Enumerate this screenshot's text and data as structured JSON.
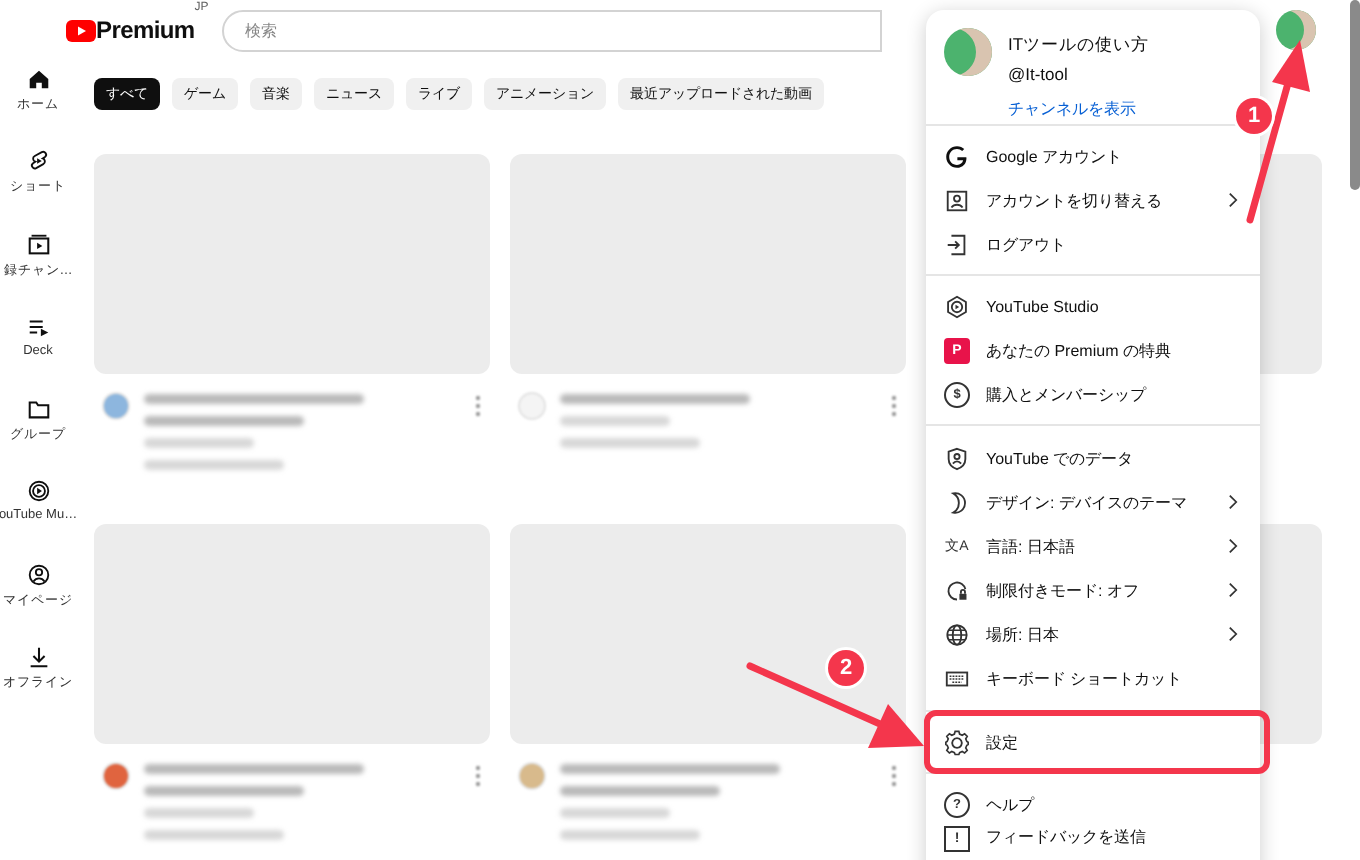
{
  "logo": {
    "text": "Premium",
    "region": "JP"
  },
  "search": {
    "placeholder": "検索"
  },
  "sidebar": {
    "items": [
      {
        "label": "ホーム"
      },
      {
        "label": "ショート"
      },
      {
        "label": "録チャン…"
      },
      {
        "label": "Deck"
      },
      {
        "label": "グループ"
      },
      {
        "label": "ouTube Mu…"
      },
      {
        "label": "マイページ"
      },
      {
        "label": "オフライン"
      }
    ]
  },
  "chips": [
    {
      "label": "すべて",
      "selected": true
    },
    {
      "label": "ゲーム",
      "selected": false
    },
    {
      "label": "音楽",
      "selected": false
    },
    {
      "label": "ニュース",
      "selected": false
    },
    {
      "label": "ライブ",
      "selected": false
    },
    {
      "label": "アニメーション",
      "selected": false
    },
    {
      "label": "最近アップロードされた動画",
      "selected": false
    }
  ],
  "videos": [
    {
      "kind": "two-line",
      "color": "#8db6de"
    },
    {
      "kind": "one-line",
      "color": "#f4f4f4"
    },
    {
      "kind": "two-line",
      "color": "#e0643f"
    },
    {
      "kind": "two-line",
      "color": "#d8ba8c"
    }
  ],
  "account_menu": {
    "name": "ITツールの使い方",
    "handle": "@It-tool",
    "link": "チャンネルを表示",
    "sections": [
      {
        "items": [
          {
            "label": "Google アカウント",
            "submenu": false,
            "highlighted": false
          },
          {
            "label": "アカウントを切り替える",
            "submenu": true,
            "highlighted": false
          },
          {
            "label": "ログアウト",
            "submenu": false,
            "highlighted": false
          }
        ]
      },
      {
        "items": [
          {
            "label": "YouTube Studio",
            "submenu": false,
            "highlighted": false
          },
          {
            "label": "あなたの Premium の特典",
            "icon_text": "P",
            "submenu": false,
            "highlighted": false
          },
          {
            "label": "購入とメンバーシップ",
            "icon_text": "$",
            "submenu": false,
            "highlighted": false
          }
        ]
      },
      {
        "items": [
          {
            "label": "YouTube でのデータ",
            "submenu": false,
            "highlighted": false
          },
          {
            "label": "デザイン: デバイスのテーマ",
            "submenu": true,
            "highlighted": false
          },
          {
            "label": "言語: 日本語",
            "icon_text": "文A",
            "submenu": true,
            "highlighted": false
          },
          {
            "label": "制限付きモード: オフ",
            "submenu": true,
            "highlighted": false
          },
          {
            "label": "場所: 日本",
            "submenu": true,
            "highlighted": false
          },
          {
            "label": "キーボード ショートカット",
            "submenu": false,
            "highlighted": false
          }
        ]
      },
      {
        "items": [
          {
            "label": "設定",
            "submenu": false,
            "highlighted": true
          }
        ]
      },
      {
        "items": [
          {
            "label": "ヘルプ",
            "icon_text": "?",
            "submenu": false,
            "highlighted": false
          },
          {
            "label": "フィードバックを送信",
            "icon_text": "!",
            "submenu": false,
            "highlighted": false
          }
        ]
      }
    ]
  },
  "annotations": [
    {
      "number": "1"
    },
    {
      "number": "2"
    }
  ]
}
